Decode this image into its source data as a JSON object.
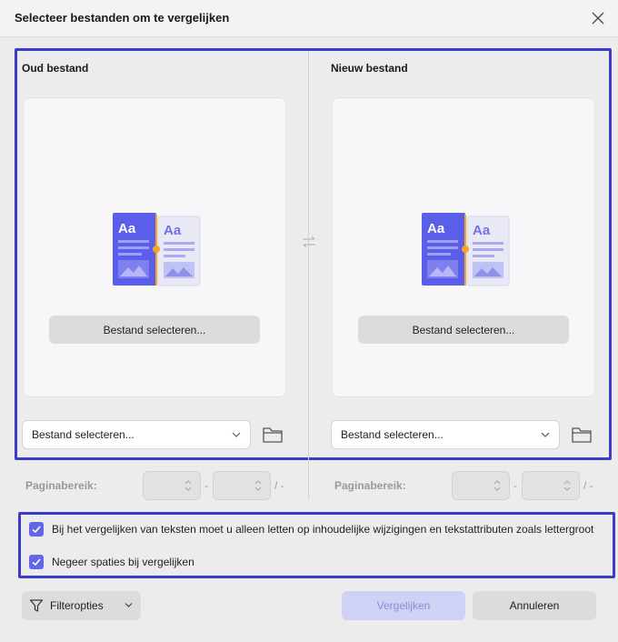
{
  "dialog": {
    "title": "Selecteer bestanden om te vergelijken"
  },
  "old_file": {
    "heading": "Oud bestand",
    "select_button": "Bestand selecteren...",
    "combo_value": "Bestand selecteren..."
  },
  "new_file": {
    "heading": "Nieuw bestand",
    "select_button": "Bestand selecteren...",
    "combo_value": "Bestand selecteren..."
  },
  "page_range": {
    "label": "Paginabereik:",
    "dash": "-",
    "slash": "/ -"
  },
  "options": {
    "text_attributes_only": {
      "label": "Bij het vergelijken van teksten moet u alleen letten op inhoudelijke wijzigingen en tekstattributen zoals lettergroot",
      "checked": true
    },
    "ignore_spaces": {
      "label": "Negeer spaties bij vergelijken",
      "checked": true
    }
  },
  "footer": {
    "filter_label": "Filteropties",
    "compare_label": "Vergelijken",
    "cancel_label": "Annuleren"
  },
  "illustration": {
    "glyph_left": "Aa",
    "glyph_right": "Aa"
  },
  "icons": {
    "close": "close-icon",
    "swap": "swap-arrows-icon",
    "folder": "folder-icon",
    "chevron": "chevron-down-icon",
    "filter": "filter-icon",
    "check": "checkmark-icon"
  },
  "colors": {
    "accent": "#3c3ccc",
    "checkbox": "#6366e6",
    "compare_disabled_bg": "#cfd1f5",
    "compare_disabled_text": "#8c8ed9",
    "illustration_blue": "#5b5ee8",
    "illustration_orange": "#f5a524"
  }
}
